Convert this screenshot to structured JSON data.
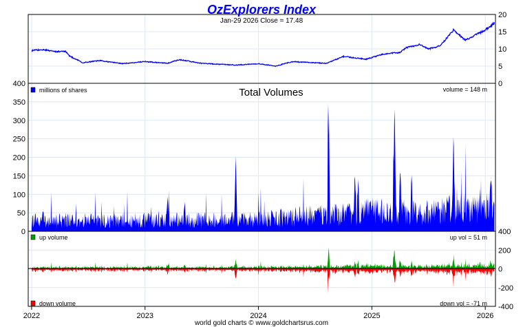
{
  "chart_data": [
    {
      "type": "line",
      "title": "OzExplorers Index",
      "subtitle": "Jan-29  2026   Close = 17.48",
      "ylim": [
        0,
        20
      ],
      "yticks": [
        0,
        5,
        10,
        15,
        20
      ],
      "x": [
        2022.0,
        2022.1,
        2022.2,
        2022.3,
        2022.33,
        2022.45,
        2022.6,
        2022.8,
        2023.0,
        2023.2,
        2023.3,
        2023.5,
        2023.8,
        2024.0,
        2024.15,
        2024.3,
        2024.6,
        2024.75,
        2024.95,
        2025.1,
        2025.25,
        2025.3,
        2025.42,
        2025.5,
        2025.6,
        2025.72,
        2025.76,
        2025.82,
        2025.9,
        2026.0,
        2026.08
      ],
      "y": [
        9.5,
        9.8,
        9.2,
        9.3,
        8.0,
        6.0,
        6.6,
        5.7,
        6.3,
        5.8,
        6.9,
        5.8,
        5.3,
        5.7,
        5.0,
        6.3,
        5.8,
        7.8,
        7.0,
        8.5,
        9.0,
        10.3,
        11.3,
        10.0,
        10.8,
        15.5,
        14.5,
        12.5,
        13.8,
        15.5,
        17.48
      ]
    },
    {
      "type": "area",
      "title": "Total Volumes",
      "legend": "millions of shares",
      "annotation": "volume = 148 m",
      "ylim": [
        0,
        400
      ],
      "yticks": [
        0,
        50,
        100,
        150,
        200,
        250,
        300,
        350,
        400
      ],
      "baseline": [
        [
          2022.0,
          30
        ],
        [
          2023.0,
          30
        ],
        [
          2024.0,
          32
        ],
        [
          2024.6,
          45
        ],
        [
          2025.0,
          55
        ],
        [
          2025.5,
          50
        ],
        [
          2026.08,
          75
        ]
      ],
      "spikes": [
        [
          2022.1,
          60
        ],
        [
          2023.2,
          95
        ],
        [
          2023.35,
          80
        ],
        [
          2023.8,
          215
        ],
        [
          2024.2,
          65
        ],
        [
          2024.62,
          355
        ],
        [
          2024.85,
          160
        ],
        [
          2024.88,
          145
        ],
        [
          2025.2,
          360
        ],
        [
          2025.25,
          175
        ],
        [
          2025.35,
          155
        ],
        [
          2025.72,
          275
        ],
        [
          2026.05,
          148
        ]
      ]
    },
    {
      "type": "area",
      "legend_up": "up volume",
      "legend_down": "down volume",
      "annotation_up": "up vol = 51 m",
      "annotation_down": "down vol = -71 m",
      "ylim": [
        -400,
        400
      ],
      "yticks": [
        -400,
        -200,
        0,
        200,
        400
      ]
    }
  ],
  "x_axis": {
    "ticks": [
      "2022",
      "2023",
      "2024",
      "2025",
      "2026"
    ],
    "range": [
      2021.97,
      2026.09
    ]
  },
  "footer": "world gold charts © www.goldchartsrus.com",
  "colors": {
    "price": "#0000ff",
    "volume": "#0000ff",
    "up": "#00a000",
    "down": "#ff0000",
    "grid": "#dde8f4"
  }
}
